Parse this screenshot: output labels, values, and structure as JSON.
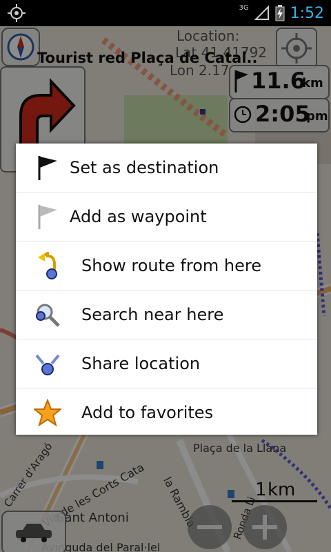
{
  "status_bar": {
    "time": "1:52",
    "network": "3G"
  },
  "map_overlay": {
    "street_title": "Tourist red Plaça de Catal..",
    "location_label": "Location:",
    "lat_text": "Lat 41.41792",
    "lon_text": "Lon 2.17",
    "distance_value": "11.6",
    "distance_unit": "km",
    "time_value": "2:05",
    "time_unit": "pm",
    "scale_value": "1",
    "scale_unit": "km"
  },
  "map_labels": {
    "placa_llana": "Plaça de la Llana",
    "sant_antoni": "Sant Antoni",
    "rambla": "la Rambla",
    "corts": "Gran Via de les Corts Cata",
    "arago": "Carrer d'Aragó",
    "parallel": "Avinguda del Paral·lel",
    "ronda": "Ronda Li"
  },
  "menu": {
    "items": [
      {
        "label": "Set as destination",
        "icon": "black-flag-icon"
      },
      {
        "label": "Add as waypoint",
        "icon": "grey-flag-icon"
      },
      {
        "label": "Show route from here",
        "icon": "route-arrow-icon"
      },
      {
        "label": "Search near here",
        "icon": "magnifier-icon"
      },
      {
        "label": "Share location",
        "icon": "share-icon"
      },
      {
        "label": "Add to favorites",
        "icon": "star-icon"
      }
    ]
  },
  "colors": {
    "status_time": "#33b5e5",
    "turn_arrow": "#d42a1c",
    "star": "#f7a21d"
  }
}
